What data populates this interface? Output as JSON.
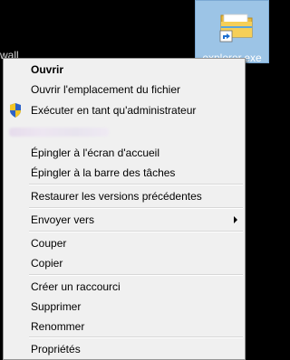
{
  "desktop": {
    "background_label": "wall",
    "icon": {
      "name": "folder-shortcut-icon",
      "label": "explorer.exe"
    }
  },
  "context_menu": {
    "items": [
      {
        "label": "Ouvrir",
        "bold": true
      },
      {
        "label": "Ouvrir l'emplacement du fichier"
      },
      {
        "label": "Exécuter en tant qu'administrateur",
        "icon": "shield-icon"
      },
      {
        "label": "Épingler à l'écran d'accueil"
      },
      {
        "label": "Épingler à la barre des tâches"
      },
      {
        "label": "Restaurer les versions précédentes"
      },
      {
        "label": "Envoyer vers",
        "submenu": true
      },
      {
        "label": "Couper"
      },
      {
        "label": "Copier"
      },
      {
        "label": "Créer un raccourci"
      },
      {
        "label": "Supprimer"
      },
      {
        "label": "Renommer"
      },
      {
        "label": "Propriétés"
      }
    ]
  },
  "colors": {
    "desktop_background": "#000000",
    "menu_background": "#f0f0f0",
    "selection_highlight": "#9cc4e6"
  }
}
